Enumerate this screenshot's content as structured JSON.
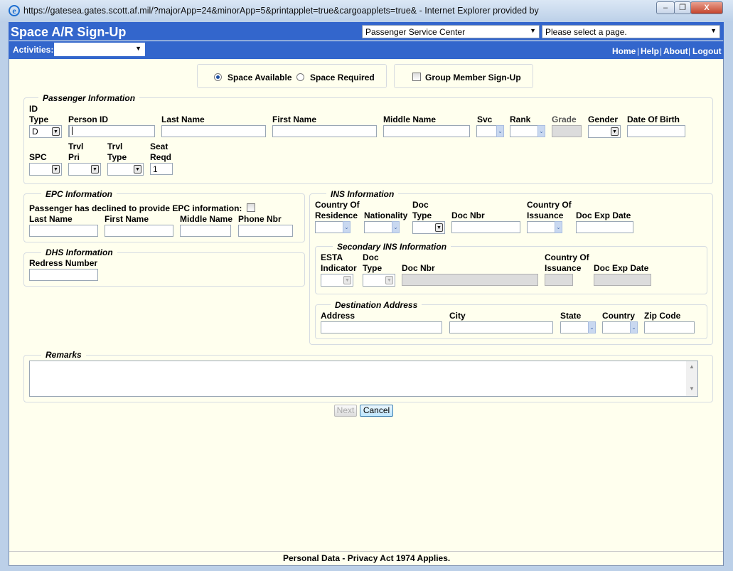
{
  "window": {
    "title": "https://gatesea.gates.scott.af.mil/?majorApp=24&minorApp=5&printapplet=true&cargoapplets=true&  - Internet Explorer provided by",
    "minimize": "–",
    "restore": "❐",
    "close": "X"
  },
  "header": {
    "app_title": "Space A/R Sign-Up",
    "location_select": "Passenger Service Center",
    "page_select": "Please select a page.",
    "activities_label": "Activities:",
    "activities_value": "",
    "nav": {
      "home": "Home",
      "help": "Help",
      "about": "About",
      "logout": "Logout",
      "sep": "|"
    }
  },
  "signup_type": {
    "space_available": "Space Available",
    "space_required": "Space Required",
    "selected": "Space Available",
    "group_member": "Group Member Sign-Up"
  },
  "passenger": {
    "legend": "Passenger Information",
    "id_type": "ID\nType",
    "id_type_value": "D",
    "person_id": "Person ID",
    "last_name": "Last Name",
    "first_name": "First Name",
    "middle_name": "Middle Name",
    "svc": "Svc",
    "rank": "Rank",
    "grade": "Grade",
    "gender": "Gender",
    "dob": "Date Of Birth",
    "spc": "SPC",
    "trvl_pri": "Trvl\nPri",
    "trvl_type": "Trvl\nType",
    "seat_reqd": "Seat\nReqd",
    "seat_reqd_value": "1"
  },
  "epc": {
    "legend": "EPC Information",
    "declined": "Passenger has declined to provide EPC information:",
    "last_name": "Last Name",
    "first_name": "First Name",
    "middle_name": "Middle Name",
    "phone": "Phone Nbr"
  },
  "dhs": {
    "legend": "DHS Information",
    "redress": "Redress Number"
  },
  "ins": {
    "legend": "INS Information",
    "residence": "Country Of\nResidence",
    "nationality": "Nationality",
    "doc_type": "Doc\nType",
    "doc_nbr": "Doc Nbr",
    "issuance": "Country Of\nIssuance",
    "doc_exp": "Doc Exp Date"
  },
  "secondary_ins": {
    "legend": "Secondary INS Information",
    "esta": "ESTA\nIndicator",
    "doc_type": "Doc\nType",
    "doc_nbr": "Doc Nbr",
    "issuance": "Country Of\nIssuance",
    "doc_exp": "Doc Exp Date"
  },
  "destination": {
    "legend": "Destination Address",
    "address": "Address",
    "city": "City",
    "state": "State",
    "country": "Country",
    "zip": "Zip Code"
  },
  "remarks": {
    "legend": "Remarks"
  },
  "buttons": {
    "next": "Next",
    "cancel": "Cancel"
  },
  "footer": {
    "text": "Personal Data - Privacy Act 1974 Applies."
  }
}
